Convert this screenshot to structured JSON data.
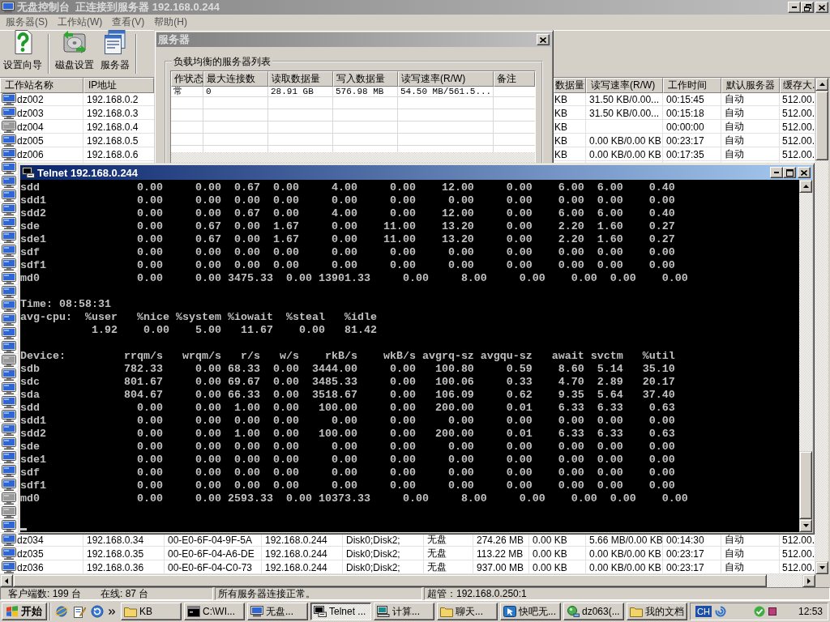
{
  "main_window": {
    "title": "无盘控制台  正连接到服务器 192.168.0.244",
    "active": false
  },
  "menu": [
    "服务器(S)",
    "工作站(W)",
    "查看(V)",
    "帮助(H)"
  ],
  "toolbar": [
    {
      "label": "设置向导",
      "kind": "wizard"
    },
    {
      "label": "磁盘设置",
      "kind": "disk"
    },
    {
      "label": "服务器",
      "kind": "server"
    }
  ],
  "server_dialog": {
    "title": "服务器",
    "active": false,
    "group_label": "负载均衡的服务器列表",
    "columns": [
      "作状态",
      "最大连接数",
      "读取数据量",
      "写入数据量",
      "读写速率(R/W)",
      "备注"
    ],
    "rows": [
      [
        "常",
        "0",
        "28.91 GB",
        "576.98 MB",
        "54.50 MB/561.5..."
      ]
    ]
  },
  "workstations": {
    "header": {
      "name": "工作站名称",
      "ip": "IP地址",
      "column_8": "数据量",
      "rw_rate": "读写速率(R/W)",
      "work_time": "工作时间",
      "default_server": "默认服务器",
      "column_12": "缓存大."
    },
    "rows": [
      {
        "online": true,
        "name": "dz002",
        "ip": "192.168.0.2",
        "column_8": "KB",
        "rw_rate": "31.50 KB/0.00...",
        "work_time": "00:15:45",
        "default_server": "自动",
        "column_12": "512.00."
      },
      {
        "online": true,
        "name": "dz003",
        "ip": "192.168.0.3",
        "column_8": "KB",
        "rw_rate": "31.50 KB/0.00...",
        "work_time": "00:15:18",
        "default_server": "自动",
        "column_12": "512.00."
      },
      {
        "online": false,
        "name": "dz004",
        "ip": "192.168.0.4",
        "column_8": "KB",
        "work_time": "00:00:00",
        "default_server": "自动",
        "column_12": "512.00."
      },
      {
        "online": true,
        "name": "dz005",
        "ip": "192.168.0.5",
        "column_8": "KB",
        "rw_rate": "0.00 KB/0.00 KB",
        "work_time": "00:23:17",
        "default_server": "自动",
        "column_12": "512.00."
      },
      {
        "online": true,
        "name": "dz006",
        "ip": "192.168.0.6",
        "column_8": "KB",
        "rw_rate": "0.00 KB/0.00 KB",
        "work_time": "00:17:35",
        "default_server": "自动",
        "column_12": "512.00."
      },
      {
        "online": true
      },
      {
        "online": true
      },
      {
        "online": true
      },
      {
        "online": true
      },
      {
        "online": true
      },
      {
        "online": true
      },
      {
        "online": true
      },
      {
        "online": true
      },
      {
        "online": true
      },
      {
        "online": true
      },
      {
        "online": true
      },
      {
        "online": true
      },
      {
        "online": true
      },
      {
        "online": true
      },
      {
        "online": false
      },
      {
        "online": true
      },
      {
        "online": true
      },
      {
        "online": true
      },
      {
        "online": true
      },
      {
        "online": true
      },
      {
        "online": true
      },
      {
        "online": true
      },
      {
        "online": true
      },
      {
        "online": true
      },
      {
        "online": false
      },
      {
        "online": false
      },
      {
        "online": true
      },
      {
        "online": true,
        "name": "dz034",
        "ip": "192.168.0.34",
        "column_3": "00-E0-6F-04-9F-5A",
        "column_4": "192.168.0.244",
        "column_5": "Disk0;Disk2;",
        "column_6": "无盘",
        "column_7": "274.26 MB",
        "column_8": "0.00 KB",
        "rw_rate": "5.66 MB/0.00 KB",
        "work_time": "00:14:30",
        "default_server": "自动",
        "column_12": "512.00."
      },
      {
        "online": true,
        "name": "dz035",
        "ip": "192.168.0.35",
        "column_3": "00-E0-6F-04-A6-DE",
        "column_4": "192.168.0.244",
        "column_5": "Disk0;Disk2;",
        "column_6": "无盘",
        "column_7": "113.22 MB",
        "column_8": "0.00 KB",
        "rw_rate": "0.00 KB/0.00 KB",
        "work_time": "00:23:17",
        "default_server": "自动",
        "column_12": "512.00."
      },
      {
        "online": true,
        "name": "dz036",
        "ip": "192.168.0.36",
        "column_3": "00-E0-6F-04-C0-73",
        "column_4": "192.168.0.244",
        "column_5": "Disk0;Disk2;",
        "column_6": "无盘",
        "column_7": "937.00 MB",
        "column_8": "0.00 KB",
        "rw_rate": "0.00 KB/0.00 KB",
        "work_time": "00:23:17",
        "default_server": "自动",
        "column_12": "512.00."
      }
    ]
  },
  "telnet_window": {
    "title": "Telnet 192.168.0.244",
    "active": true,
    "blocks": [
      [
        "sdd               0.00     0.00  0.67  0.00     4.00     0.00    12.00     0.00    6.00  6.00    0.40",
        "sdd1              0.00     0.00  0.00  0.00     0.00     0.00     0.00     0.00    0.00  0.00    0.00",
        "sdd2              0.00     0.00  0.67  0.00     4.00     0.00    12.00     0.00    6.00  6.00    0.40",
        "sde               0.00     0.67  0.00  1.67     0.00    11.00    13.20     0.00    2.20  1.60    0.27",
        "sde1              0.00     0.67  0.00  1.67     0.00    11.00    13.20     0.00    2.20  1.60    0.27",
        "sdf               0.00     0.00  0.00  0.00     0.00     0.00     0.00     0.00    0.00  0.00    0.00",
        "sdf1              0.00     0.00  0.00  0.00     0.00     0.00     0.00     0.00    0.00  0.00    0.00",
        "md0               0.00     0.00 3475.33  0.00 13901.33     0.00     8.00     0.00    0.00  0.00    0.00"
      ],
      [
        "Time: 08:58:31",
        "avg-cpu:  %user   %nice %system %iowait  %steal   %idle",
        "           1.92    0.00    5.00   11.67    0.00   81.42"
      ],
      [
        "Device:         rrqm/s   wrqm/s   r/s   w/s    rkB/s    wkB/s avgrq-sz avgqu-sz   await svctm   %util",
        "sdb             782.33     0.00 68.33  0.00  3444.00     0.00   100.80     0.59    8.60  5.14   35.10",
        "sdc             801.67     0.00 69.67  0.00  3485.33     0.00   100.06     0.33    4.70  2.89   20.17",
        "sda             804.67     0.00 66.33  0.00  3518.67     0.00   106.09     0.62    9.35  5.64   37.40",
        "sdd               0.00     0.00  1.00  0.00   100.00     0.00   200.00     0.01    6.33  6.33    0.63",
        "sdd1              0.00     0.00  0.00  0.00     0.00     0.00     0.00     0.00    0.00  0.00    0.00",
        "sdd2              0.00     0.00  1.00  0.00   100.00     0.00   200.00     0.01    6.33  6.33    0.63",
        "sde               0.00     0.00  0.00  0.00     0.00     0.00     0.00     0.00    0.00  0.00    0.00",
        "sde1              0.00     0.00  0.00  0.00     0.00     0.00     0.00     0.00    0.00  0.00    0.00",
        "sdf               0.00     0.00  0.00  0.00     0.00     0.00     0.00     0.00    0.00  0.00    0.00",
        "sdf1              0.00     0.00  0.00  0.00     0.00     0.00     0.00     0.00    0.00  0.00    0.00",
        "md0               0.00     0.00 2593.33  0.00 10373.33     0.00     8.00     0.00    0.00  0.00    0.00"
      ]
    ]
  },
  "status_bar": {
    "panels": [
      [
        "客户端数: 199 台",
        "在线: 87 台"
      ],
      [
        "所有服务器连接正常。"
      ],
      [
        "超管：192.168.0.250:1"
      ]
    ]
  },
  "taskbar": {
    "start": "开始",
    "tasks": [
      {
        "label": "KB",
        "kind": "folder",
        "selected": false
      },
      {
        "label": "C:\\WI...",
        "kind": "console",
        "selected": false
      },
      {
        "label": "无盘...",
        "kind": "monitor",
        "selected": false
      },
      {
        "label": "Telnet ...",
        "kind": "terminal",
        "selected": true
      },
      {
        "label": "计算...",
        "kind": "computer",
        "selected": false
      },
      {
        "label": "聊天...",
        "kind": "folder",
        "selected": false
      },
      {
        "label": "快吧无...",
        "kind": "app",
        "selected": false
      },
      {
        "label": "dz063(...",
        "kind": "network",
        "selected": false
      },
      {
        "label": "我的文档",
        "kind": "folder",
        "selected": false
      }
    ],
    "language": "CH",
    "clock": "12:53"
  }
}
